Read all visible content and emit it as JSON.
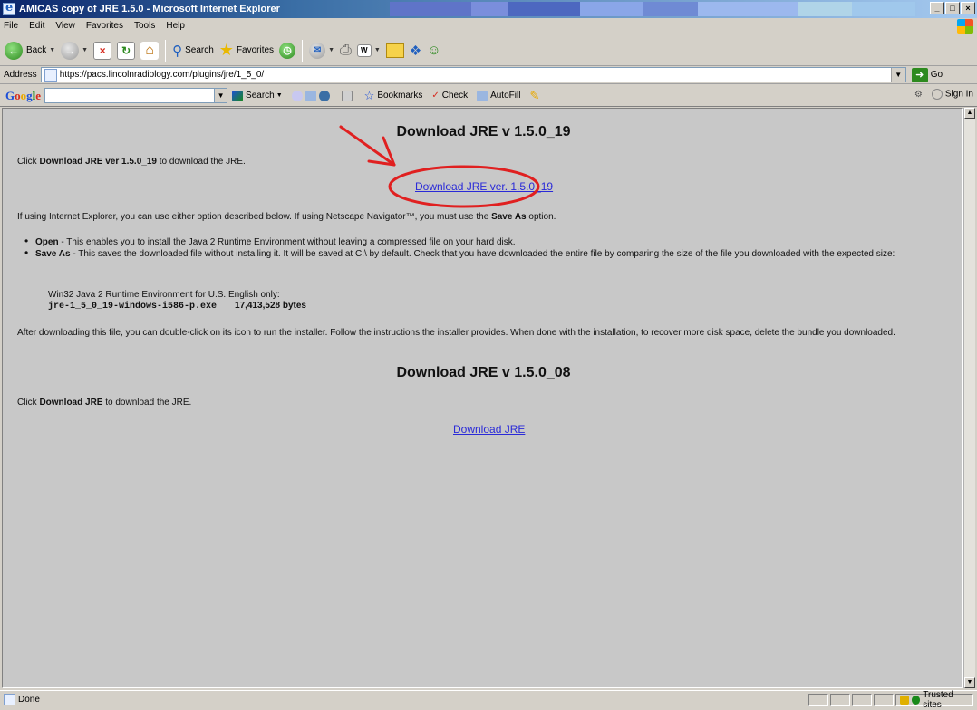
{
  "window": {
    "title": "AMICAS copy of JRE 1.5.0 - Microsoft Internet Explorer",
    "controls": [
      "_",
      "□",
      "×"
    ]
  },
  "menu": [
    "File",
    "Edit",
    "View",
    "Favorites",
    "Tools",
    "Help"
  ],
  "toolbar": {
    "back_label": "Back",
    "search_label": "Search",
    "favorites_label": "Favorites"
  },
  "address": {
    "label": "Address",
    "url": "https://pacs.lincolnradiology.com/plugins/jre/1_5_0/",
    "go_label": "Go"
  },
  "google_bar": {
    "logo": "Google",
    "search_label": "Search",
    "bookmarks_label": "Bookmarks",
    "check_label": "Check",
    "autofill_label": "AutoFill",
    "sign_in_label": "Sign In"
  },
  "content": {
    "heading1": "Download JRE v 1.5.0_19",
    "click_prefix": "Click ",
    "click_bold1": "Download JRE ver 1.5.0_19",
    "click_suffix1": " to download the JRE.",
    "link1": "Download JRE ver. 1.5.0_19",
    "options_prefix": "If using Internet Explorer, you can use either option described below. If using Netscape Navigator™, you must use the ",
    "options_bold": "Save As",
    "options_suffix": " option.",
    "bullet_open_bold": "Open",
    "bullet_open_text": " - This enables you to install the Java 2 Runtime Environment without leaving a compressed file on your hard disk.",
    "bullet_save_bold": "Save As",
    "bullet_save_text": " - This saves the downloaded file without installing it. It will be saved at C:\\ by default. Check that you have downloaded the entire file by comparing the size of the file you downloaded with the expected size:",
    "win32_label": "Win32 Java 2 Runtime Environment for U.S. English only:",
    "filename": "jre-1_5_0_19-windows-i586-p.exe",
    "filesize": "17,413,528 bytes",
    "after_text": "After downloading this file, you can double-click on its icon to run the installer. Follow the instructions the installer provides. When done with the installation, to recover more disk space, delete the bundle you downloaded.",
    "heading2": "Download JRE v 1.5.0_08",
    "click_bold2": "Download JRE",
    "click_suffix2": " to download the JRE.",
    "link2": "Download JRE"
  },
  "status": {
    "text": "Done",
    "zone": "Trusted sites"
  },
  "colors": {
    "annotation": "#e02020",
    "link": "#2a2ad8",
    "page_background": "#c8c8c8"
  }
}
